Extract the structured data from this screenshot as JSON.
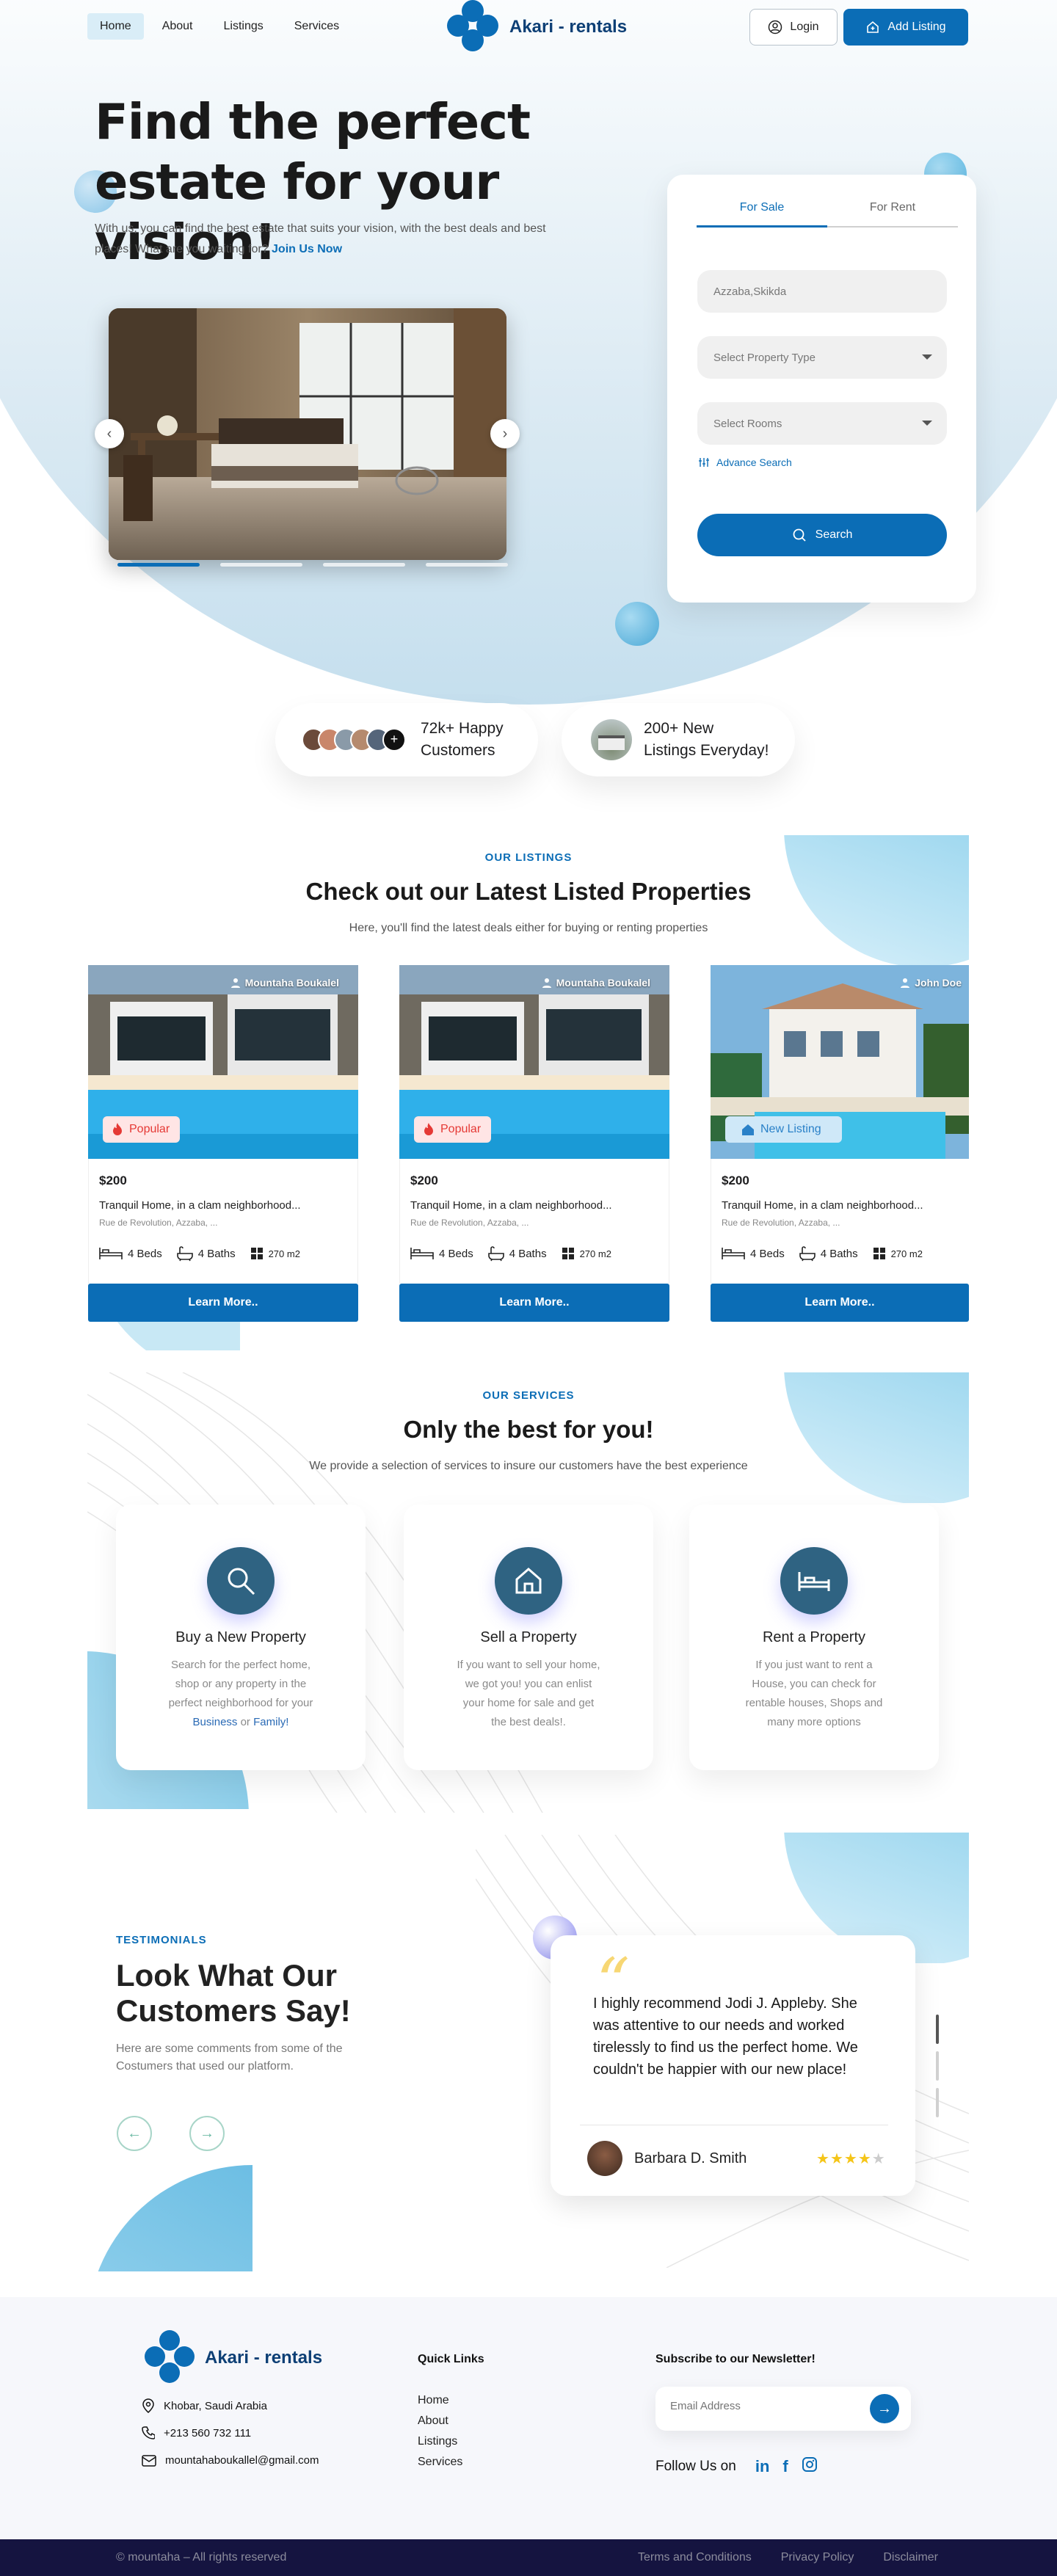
{
  "nav": {
    "links": [
      "Home",
      "About",
      "Listings",
      "Services"
    ],
    "brand": "Akari - rentals",
    "login_label": "Login",
    "add_listing_label": "Add Listing"
  },
  "hero": {
    "title": "Find the perfect estate for your vision!",
    "subtitle": "With us, you can find the best estate that suits your vision, with the best deals and best places! What are you waiting for?",
    "join_link": "Join Us Now",
    "slide_count": 4,
    "active_slide": 1
  },
  "search": {
    "tabs": [
      "For Sale",
      "For Rent"
    ],
    "location_placeholder": "Azzaba,Skikda",
    "property_type_label": "Select Property Type",
    "rooms_label": "Select Rooms",
    "advance_label": "Advance Search",
    "button_label": "Search"
  },
  "stats": {
    "customers_line1": "72k+ Happy",
    "customers_line2": "Customers",
    "listings_line1": "200+ New",
    "listings_line2": "Listings Everyday!",
    "avatar_more": "+"
  },
  "listings": {
    "eyebrow": "OUR LISTINGS",
    "title": "Check out our Latest Listed Properties",
    "subtitle": "Here, you'll find the latest deals either for buying or renting properties",
    "items": [
      {
        "owner": "Mountaha Boukalel",
        "badge": "Popular",
        "price": "$200",
        "title": "Tranquil Home, in a clam neighborhood...",
        "address": "Rue de Revolution, Azzaba, ...",
        "beds": "4 Beds",
        "baths": "4 Baths",
        "area": "270 m2",
        "button": "Learn More.."
      },
      {
        "owner": "Mountaha Boukalel",
        "badge": "Popular",
        "price": "$200",
        "title": "Tranquil Home, in a clam neighborhood...",
        "address": "Rue de Revolution, Azzaba, ...",
        "beds": "4 Beds",
        "baths": "4 Baths",
        "area": "270 m2",
        "button": "Learn More.."
      },
      {
        "owner": "John Doe",
        "badge": "New Listing",
        "price": "$200",
        "title": "Tranquil Home, in a clam neighborhood...",
        "address": "Rue de Revolution, Azzaba, ...",
        "beds": "4 Beds",
        "baths": "4 Baths",
        "area": "270 m2",
        "button": "Learn More.."
      }
    ]
  },
  "services": {
    "eyebrow": "OUR SERVICES",
    "title": "Only the best for you!",
    "subtitle": "We provide a selection of services to insure our customers have the best experience",
    "items": [
      {
        "title": "Buy a New Property",
        "text": "Search for the perfect home, shop or any property in the perfect neighborhood for your",
        "link1": "Business",
        "joiner": "or",
        "link2": "Family!"
      },
      {
        "title": "Sell a Property",
        "text": "If you want to sell your home, we got you! you can enlist your home for sale and get the best deals!."
      },
      {
        "title": "Rent a Property",
        "text": "If you just want to rent a House, you can check for rentable houses, Shops and many more options"
      }
    ]
  },
  "testimonials": {
    "eyebrow": "TESTIMONIALS",
    "title_line1": "Look What Our",
    "title_line2": "Customers Say!",
    "subtitle": "Here are some comments from some of the Costumers that used our platform.",
    "quote": "I highly recommend Jodi J. Appleby. She was attentive to our needs and worked tirelessly to find us the perfect home. We couldn't be happier with our new place!",
    "author": "Barbara D. Smith",
    "rating": 4,
    "rating_max": 5
  },
  "footer": {
    "brand": "Akari - rentals",
    "address": "Khobar, Saudi Arabia",
    "phone": "+213 560 732 111",
    "email": "mountahaboukallel@gmail.com",
    "quick_links_title": "Quick Links",
    "quick_links": [
      "Home",
      "About",
      "Listings",
      "Services"
    ],
    "newsletter_title": "Subscribe to our Newsletter!",
    "email_placeholder": "Email Address",
    "follow_label": "Follow Us on",
    "copyright": "© mountaha – All rights reserved",
    "bottom_links": [
      "Terms and Conditions",
      "Privacy Policy",
      "Disclaimer"
    ]
  },
  "colors": {
    "primary": "#0b6db6",
    "brand_dark": "#0d3f75",
    "footer_dark": "#151440",
    "accent_red": "#e53935",
    "star": "#f5c518"
  }
}
